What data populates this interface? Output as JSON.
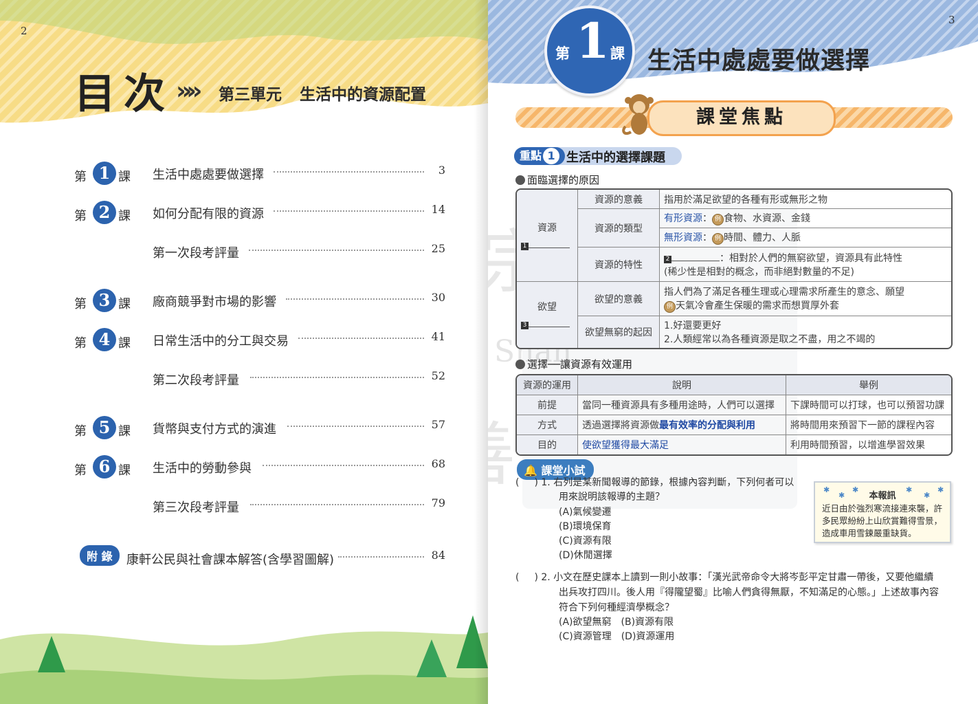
{
  "left": {
    "page_number": "2",
    "toc_title": "目次",
    "chevrons": "»",
    "unit_label": "第三單元",
    "unit_title": "生活中的資源配置",
    "entries": [
      {
        "di": "第",
        "num": "1",
        "ke": "課",
        "title": "生活中處處要做選擇",
        "page": "3"
      },
      {
        "di": "第",
        "num": "2",
        "ke": "課",
        "title": "如何分配有限的資源",
        "page": "14"
      },
      {
        "title": "第一次段考評量",
        "page": "25"
      },
      {
        "di": "第",
        "num": "3",
        "ke": "課",
        "title": "廠商競爭對市場的影響",
        "page": "30"
      },
      {
        "di": "第",
        "num": "4",
        "ke": "課",
        "title": "日常生活中的分工與交易",
        "page": "41"
      },
      {
        "title": "第二次段考評量",
        "page": "52"
      },
      {
        "di": "第",
        "num": "5",
        "ke": "課",
        "title": "貨幣與支付方式的演進",
        "page": "57"
      },
      {
        "di": "第",
        "num": "6",
        "ke": "課",
        "title": "生活中的勞動參與",
        "page": "68"
      },
      {
        "title": "第三次段考評量",
        "page": "79"
      }
    ],
    "appendix": {
      "tag": "附 錄",
      "title": "康軒公民與社會課本解答(含學習圖解)",
      "page": "84"
    }
  },
  "right": {
    "page_number": "3",
    "lesson": {
      "di": "第",
      "num": "1",
      "ke": "課",
      "title": "生活中處處要做選擇"
    },
    "focus_title": "課堂焦點",
    "keypoint": {
      "tag": "重點",
      "num": "1",
      "text": "生活中的選擇課題"
    },
    "sub1": "面臨選擇的原因",
    "table1": {
      "resource_label": "資源",
      "resource_mark": "1",
      "desire_label": "欲望",
      "desire_mark": "3",
      "r1": {
        "k": "資源的意義",
        "v": "指用於滿足欲望的各種有形或無形之物"
      },
      "r2": {
        "k": "資源的類型",
        "v1_label": "有形資源",
        "v1_sep": "：",
        "v1_ex": "例",
        "v1_text": "食物、水資源、金錢",
        "v2_label": "無形資源",
        "v2_sep": "：",
        "v2_ex": "例",
        "v2_text": "時間、體力、人脈"
      },
      "r3": {
        "k": "資源的特性",
        "mark": "2",
        "text": "：相對於人們的無窮欲望，資源具有此特性",
        "note": "(稀少性是相對的概念，而非絕對數量的不足)"
      },
      "r4": {
        "k": "欲望的意義",
        "line1": "指人們為了滿足各種生理或心理需求所產生的意念、願望",
        "ex": "例",
        "line2": "天氣冷會產生保暖的需求而想買厚外套"
      },
      "r5": {
        "k": "欲望無窮的起因",
        "line1": "1.好還要更好",
        "line2": "2.人類經常以為各種資源是取之不盡，用之不竭的"
      }
    },
    "sub2": "選擇──讓資源有效運用",
    "table2": {
      "headers": [
        "資源的運用",
        "說明",
        "舉例"
      ],
      "rows": [
        {
          "a": "前提",
          "b": "當同一種資源具有多種用途時，人們可以選擇",
          "b_hl": "",
          "c": "下課時間可以打球，也可以預習功課"
        },
        {
          "a": "方式",
          "b": "透過選擇將資源做",
          "b_hl": "最有效率的分配與利用",
          "c": "將時間用來預習下一節的課程內容"
        },
        {
          "a": "目的",
          "b": "",
          "b_hl": "使欲望獲得最大滿足",
          "c": "利用時間預習，以增進學習效果"
        }
      ]
    },
    "quiz_tag": "課堂小試",
    "q1": {
      "paren": "(",
      "paren_close": ")",
      "num": "1.",
      "stem1": "右列是某新聞報導的節錄，根據內容判斷，下列何者可以",
      "stem2": "用來說明該報導的主題？",
      "options": [
        "(A)氣候變遷",
        "(B)環境保育",
        "(C)資源有限",
        "(D)休閒選擇"
      ]
    },
    "news": {
      "title": "本報訊",
      "body": "近日由於強烈寒流接連來襲，許多民眾紛紛上山欣賞難得雪景，造成車用雪鍊嚴重缺貨。"
    },
    "q2": {
      "paren": "(",
      "paren_close": ")",
      "num": "2.",
      "stem1": "小文在歷史課本上讀到一則小故事：「漢光武帝命令大將岑彭平定甘肅一帶後，又要他繼續",
      "stem2": "出兵攻打四川。後人用『得隴望蜀』比喻人們貪得無厭，不知滿足的心態。」上述故事內容",
      "stem3": "符合下列何種經濟學概念？",
      "optA": "(A)欲望無窮",
      "optB": "(B)資源有限",
      "optC": "(C)資源管理",
      "optD": "(D)資源運用"
    },
    "watermark_brand": "Chong Shan",
    "watermark_char1": "宗",
    "watermark_char2": "善"
  },
  "colors": {
    "blue": "#2c63ae",
    "yellow": "#f7d978",
    "orange": "#f3a24e",
    "green": "#3c9a4a"
  }
}
